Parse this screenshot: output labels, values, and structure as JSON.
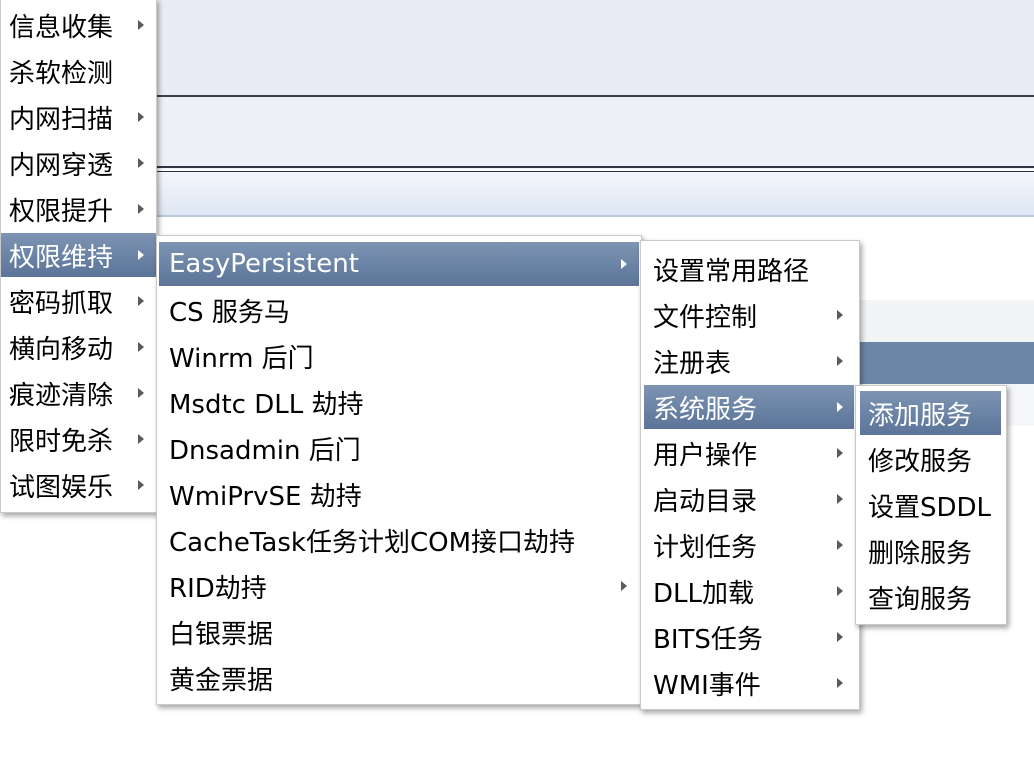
{
  "main_menu": {
    "items": [
      {
        "label": "信息收集",
        "has_sub": true
      },
      {
        "label": "杀软检测",
        "has_sub": false
      },
      {
        "label": "内网扫描",
        "has_sub": true
      },
      {
        "label": "内网穿透",
        "has_sub": true
      },
      {
        "label": "权限提升",
        "has_sub": true
      },
      {
        "label": "权限维持",
        "has_sub": true,
        "selected": true
      },
      {
        "label": "密码抓取",
        "has_sub": true
      },
      {
        "label": "横向移动",
        "has_sub": true
      },
      {
        "label": "痕迹清除",
        "has_sub": true
      },
      {
        "label": "限时免杀",
        "has_sub": true
      },
      {
        "label": "试图娱乐",
        "has_sub": true
      }
    ]
  },
  "persistence_menu": {
    "items": [
      {
        "label": "EasyPersistent",
        "has_sub": true,
        "selected": true
      },
      {
        "label": "CS 服务马",
        "has_sub": false
      },
      {
        "label": "Winrm 后门",
        "has_sub": false
      },
      {
        "label": "Msdtc DLL 劫持",
        "has_sub": false
      },
      {
        "label": "Dnsadmin 后门",
        "has_sub": false
      },
      {
        "label": "WmiPrvSE 劫持",
        "has_sub": false
      },
      {
        "label": "CacheTask任务计划COM接口劫持",
        "has_sub": false
      },
      {
        "label": "RID劫持",
        "has_sub": true
      },
      {
        "label": "白银票据",
        "has_sub": false
      },
      {
        "label": "黄金票据",
        "has_sub": false
      }
    ]
  },
  "easypersistent_menu": {
    "items": [
      {
        "label": "设置常用路径",
        "has_sub": false
      },
      {
        "label": "文件控制",
        "has_sub": true
      },
      {
        "label": "注册表",
        "has_sub": true
      },
      {
        "label": "系统服务",
        "has_sub": true,
        "selected": true
      },
      {
        "label": "用户操作",
        "has_sub": true
      },
      {
        "label": "启动目录",
        "has_sub": true
      },
      {
        "label": "计划任务",
        "has_sub": true
      },
      {
        "label": "DLL加载",
        "has_sub": true
      },
      {
        "label": "BITS任务",
        "has_sub": true
      },
      {
        "label": "WMI事件",
        "has_sub": true
      }
    ]
  },
  "service_menu": {
    "items": [
      {
        "label": "添加服务",
        "has_sub": false,
        "selected": true
      },
      {
        "label": "修改服务",
        "has_sub": false
      },
      {
        "label": "设置SDDL",
        "has_sub": false
      },
      {
        "label": "删除服务",
        "has_sub": false
      },
      {
        "label": "查询服务",
        "has_sub": false
      }
    ]
  },
  "colors": {
    "selection": "#6a83a6",
    "arrow": "#5a5a5a"
  },
  "icons": {
    "submenu_arrow": "submenu-arrow-icon"
  }
}
